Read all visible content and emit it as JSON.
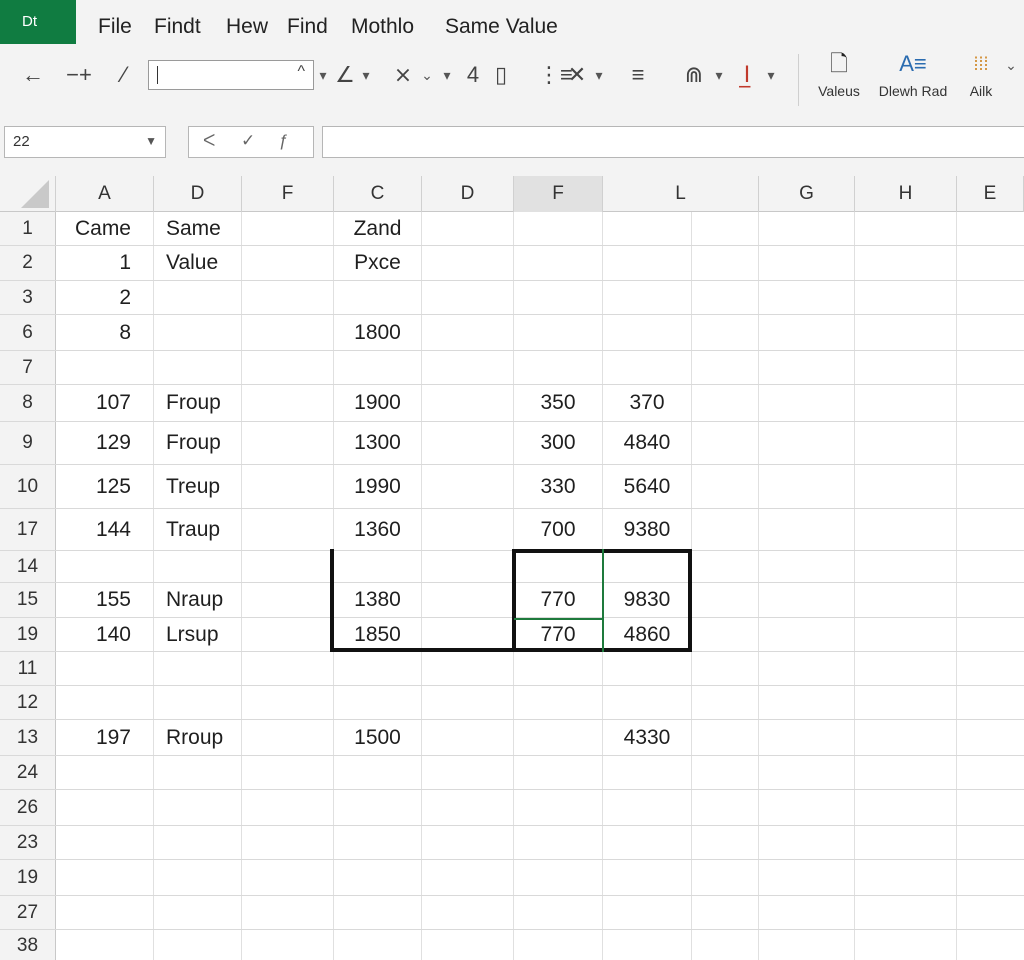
{
  "app": {
    "badge": "Dt"
  },
  "menu": [
    "File",
    "Findt",
    "Hew",
    "Find",
    "Mothlo",
    "Same Value"
  ],
  "ribbon": {
    "font_box_value": "",
    "number_label": "4",
    "big_buttons": [
      {
        "icon": "paste-values-icon",
        "label": "Valeus"
      },
      {
        "icon": "text-style-icon",
        "label": "Dlewh Rad"
      },
      {
        "icon": "grid-dots-icon",
        "label": "Ailk"
      }
    ]
  },
  "formula_bar": {
    "name_box": "22",
    "formula": ""
  },
  "columns": [
    "A",
    "D",
    "F",
    "C",
    "D",
    "F",
    "L",
    "G",
    "H",
    "E"
  ],
  "active_column_index": 5,
  "rows": [
    {
      "num": "1",
      "cells": [
        "Came",
        "Same",
        "",
        "Zand",
        "",
        "",
        ""
      ]
    },
    {
      "num": "2",
      "cells": [
        "1",
        "Value",
        "",
        "Pxce",
        "",
        "",
        ""
      ]
    },
    {
      "num": "3",
      "cells": [
        "2",
        "",
        "",
        "",
        "",
        "",
        ""
      ]
    },
    {
      "num": "6",
      "cells": [
        "8",
        "",
        "",
        "1800",
        "",
        "",
        ""
      ]
    },
    {
      "num": "7",
      "cells": [
        "",
        "",
        "",
        "",
        "",
        "",
        ""
      ]
    },
    {
      "num": "8",
      "cells": [
        "107",
        "Froup",
        "",
        "1900",
        "",
        "350",
        "370"
      ]
    },
    {
      "num": "9",
      "cells": [
        "129",
        "Froup",
        "",
        "1300",
        "",
        "300",
        "4840"
      ]
    },
    {
      "num": "10",
      "cells": [
        "125",
        "Treup",
        "",
        "1990",
        "",
        "330",
        "5640"
      ]
    },
    {
      "num": "17",
      "cells": [
        "144",
        "Traup",
        "",
        "1360",
        "",
        "700",
        "9380"
      ]
    },
    {
      "num": "14",
      "cells": [
        "",
        "",
        "",
        "",
        "",
        "",
        ""
      ]
    },
    {
      "num": "15",
      "cells": [
        "155",
        "Nraup",
        "",
        "1380",
        "",
        "770",
        "9830"
      ]
    },
    {
      "num": "19",
      "cells": [
        "140",
        "Lrsup",
        "",
        "1850",
        "",
        "770",
        "4860"
      ]
    },
    {
      "num": "11",
      "cells": [
        "",
        "",
        "",
        "",
        "",
        "",
        ""
      ]
    },
    {
      "num": "12",
      "cells": [
        "",
        "",
        "",
        "",
        "",
        "",
        ""
      ]
    },
    {
      "num": "13",
      "cells": [
        "197",
        "Rroup",
        "",
        "1500",
        "",
        "",
        "4330"
      ]
    },
    {
      "num": "24",
      "cells": [
        "",
        "",
        "",
        "",
        "",
        "",
        ""
      ]
    },
    {
      "num": "26",
      "cells": [
        "",
        "",
        "",
        "",
        "",
        "",
        ""
      ]
    },
    {
      "num": "23",
      "cells": [
        "",
        "",
        "",
        "",
        "",
        "",
        ""
      ]
    },
    {
      "num": "19",
      "cells": [
        "",
        "",
        "",
        "",
        "",
        "",
        ""
      ]
    },
    {
      "num": "27",
      "cells": [
        "",
        "",
        "",
        "",
        "",
        "",
        ""
      ]
    },
    {
      "num": "38",
      "cells": [
        "",
        "",
        "",
        "",
        "",
        "",
        ""
      ]
    }
  ],
  "colors": {
    "accent": "#107c41",
    "selection": "#111111",
    "active_cell_line": "#1e7a3c"
  }
}
